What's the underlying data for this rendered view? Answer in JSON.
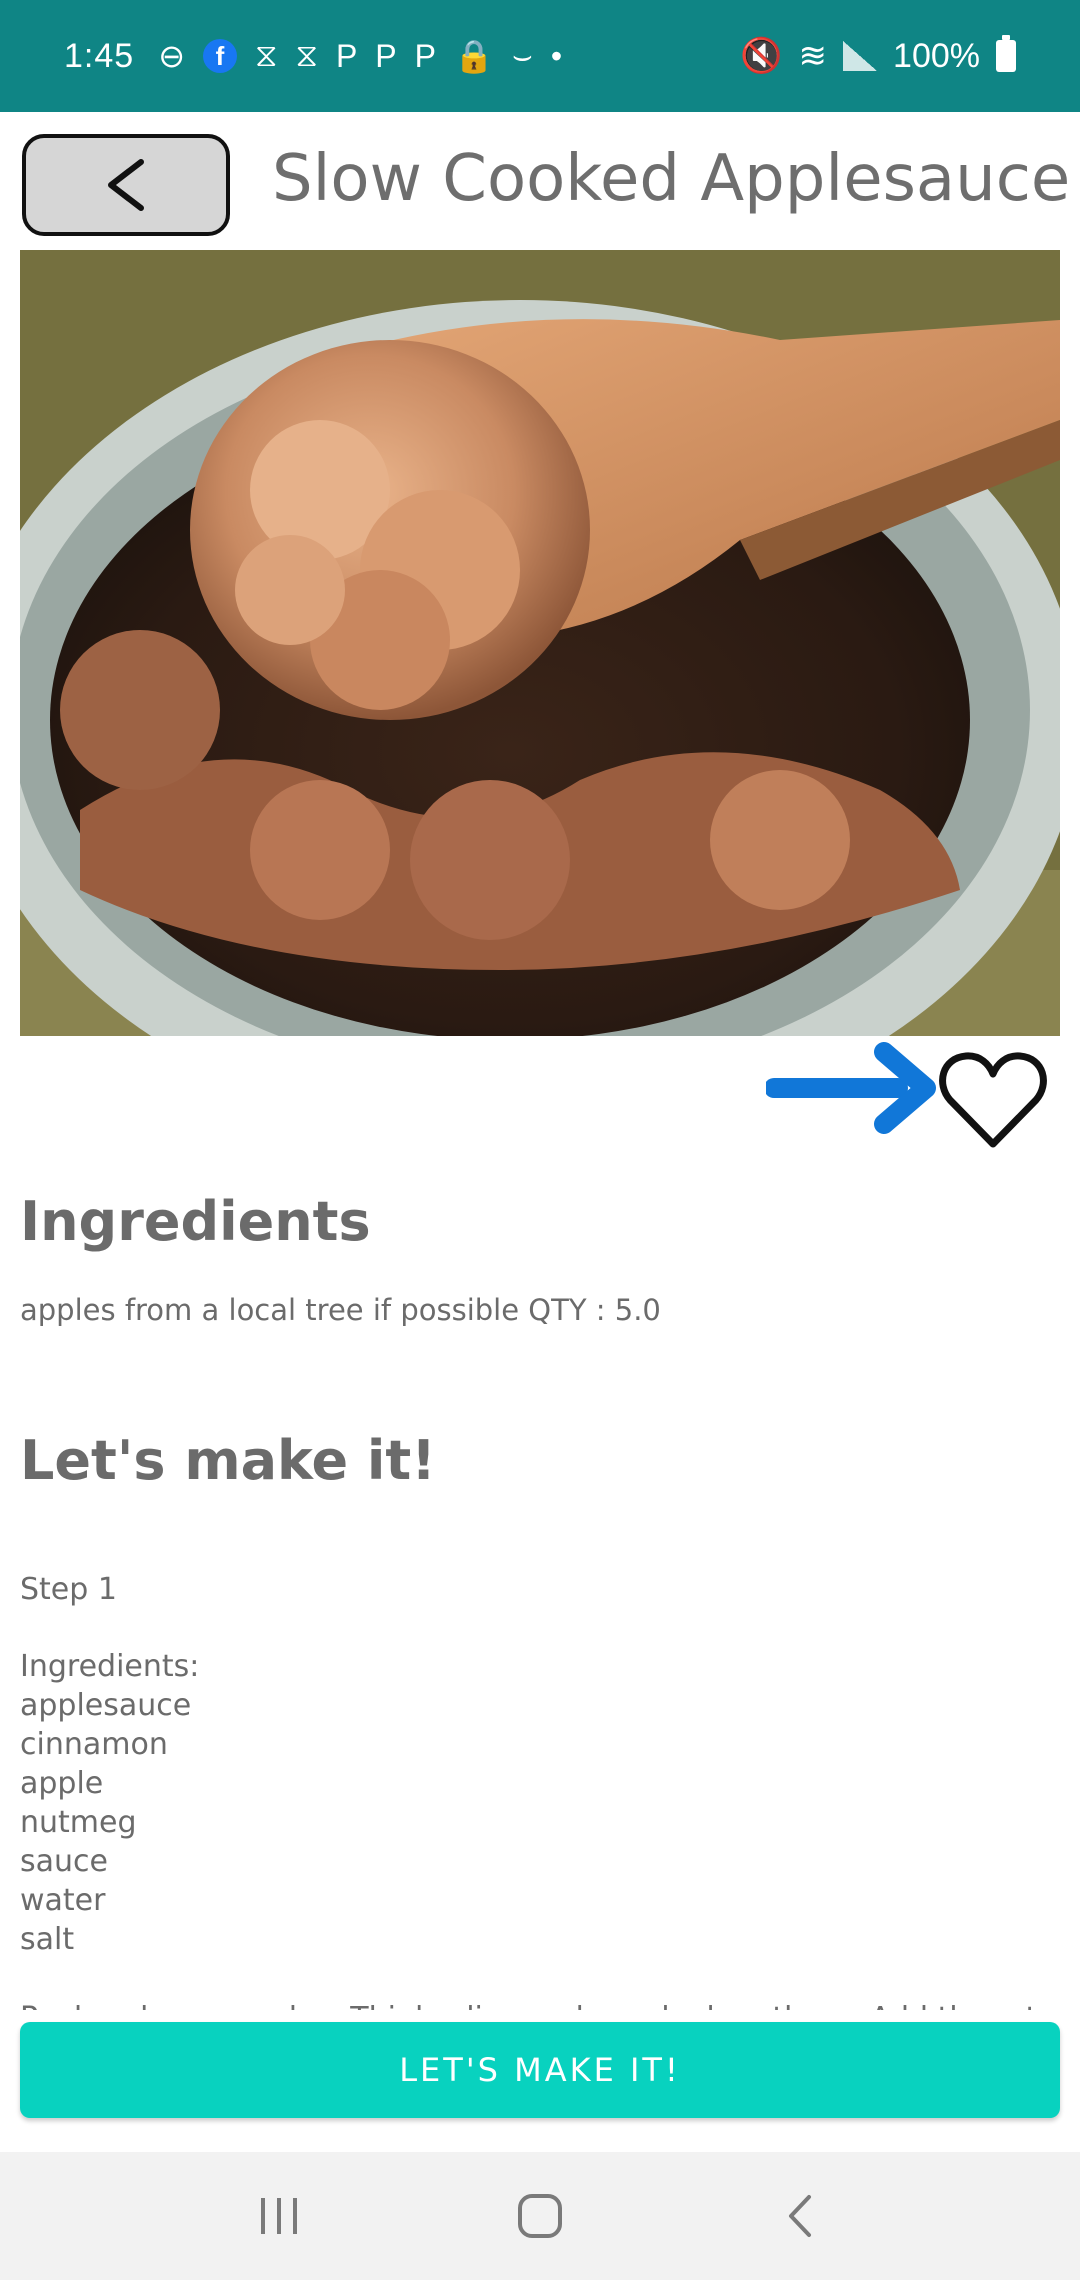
{
  "status_bar": {
    "time": "1:45",
    "battery_text": "100%",
    "icons": [
      "do-not-disturb-icon",
      "facebook-icon",
      "capcut-icon",
      "capcut-icon",
      "pinterest-icon",
      "pinterest-icon",
      "pinterest-icon",
      "lock-icon",
      "amazon-icon",
      "dot-icon",
      "mute-icon",
      "wifi-icon",
      "signal-icon",
      "battery-icon"
    ]
  },
  "header": {
    "back_icon": "chevron-left-icon",
    "title": "Slow Cooked Applesauce"
  },
  "favorite": {
    "arrow_icon": "arrow-right-icon",
    "heart_icon": "heart-outline-icon",
    "arrow_color": "#1177d8"
  },
  "ingredients": {
    "heading": "Ingredients",
    "line": "apples from a local tree if possible QTY : 5.0"
  },
  "directions": {
    "heading": "Let's make it!",
    "step_label": "Step 1",
    "ingredients_title": "Ingredients:",
    "items": [
      "applesauce",
      "cinnamon",
      "apple",
      "nutmeg",
      "sauce",
      "water",
      "salt"
    ],
    "instructions": "Peel and core apples. Thinly slice and rough chop them. Add them to a"
  },
  "cta": {
    "label": "LET'S MAKE IT!"
  },
  "nav": {
    "recents_icon": "recents-icon",
    "home_icon": "home-icon",
    "back_icon": "back-icon"
  },
  "colors": {
    "status_bar": "#0f8585",
    "cta": "#08d2bf",
    "text": "#6b6b6b"
  }
}
